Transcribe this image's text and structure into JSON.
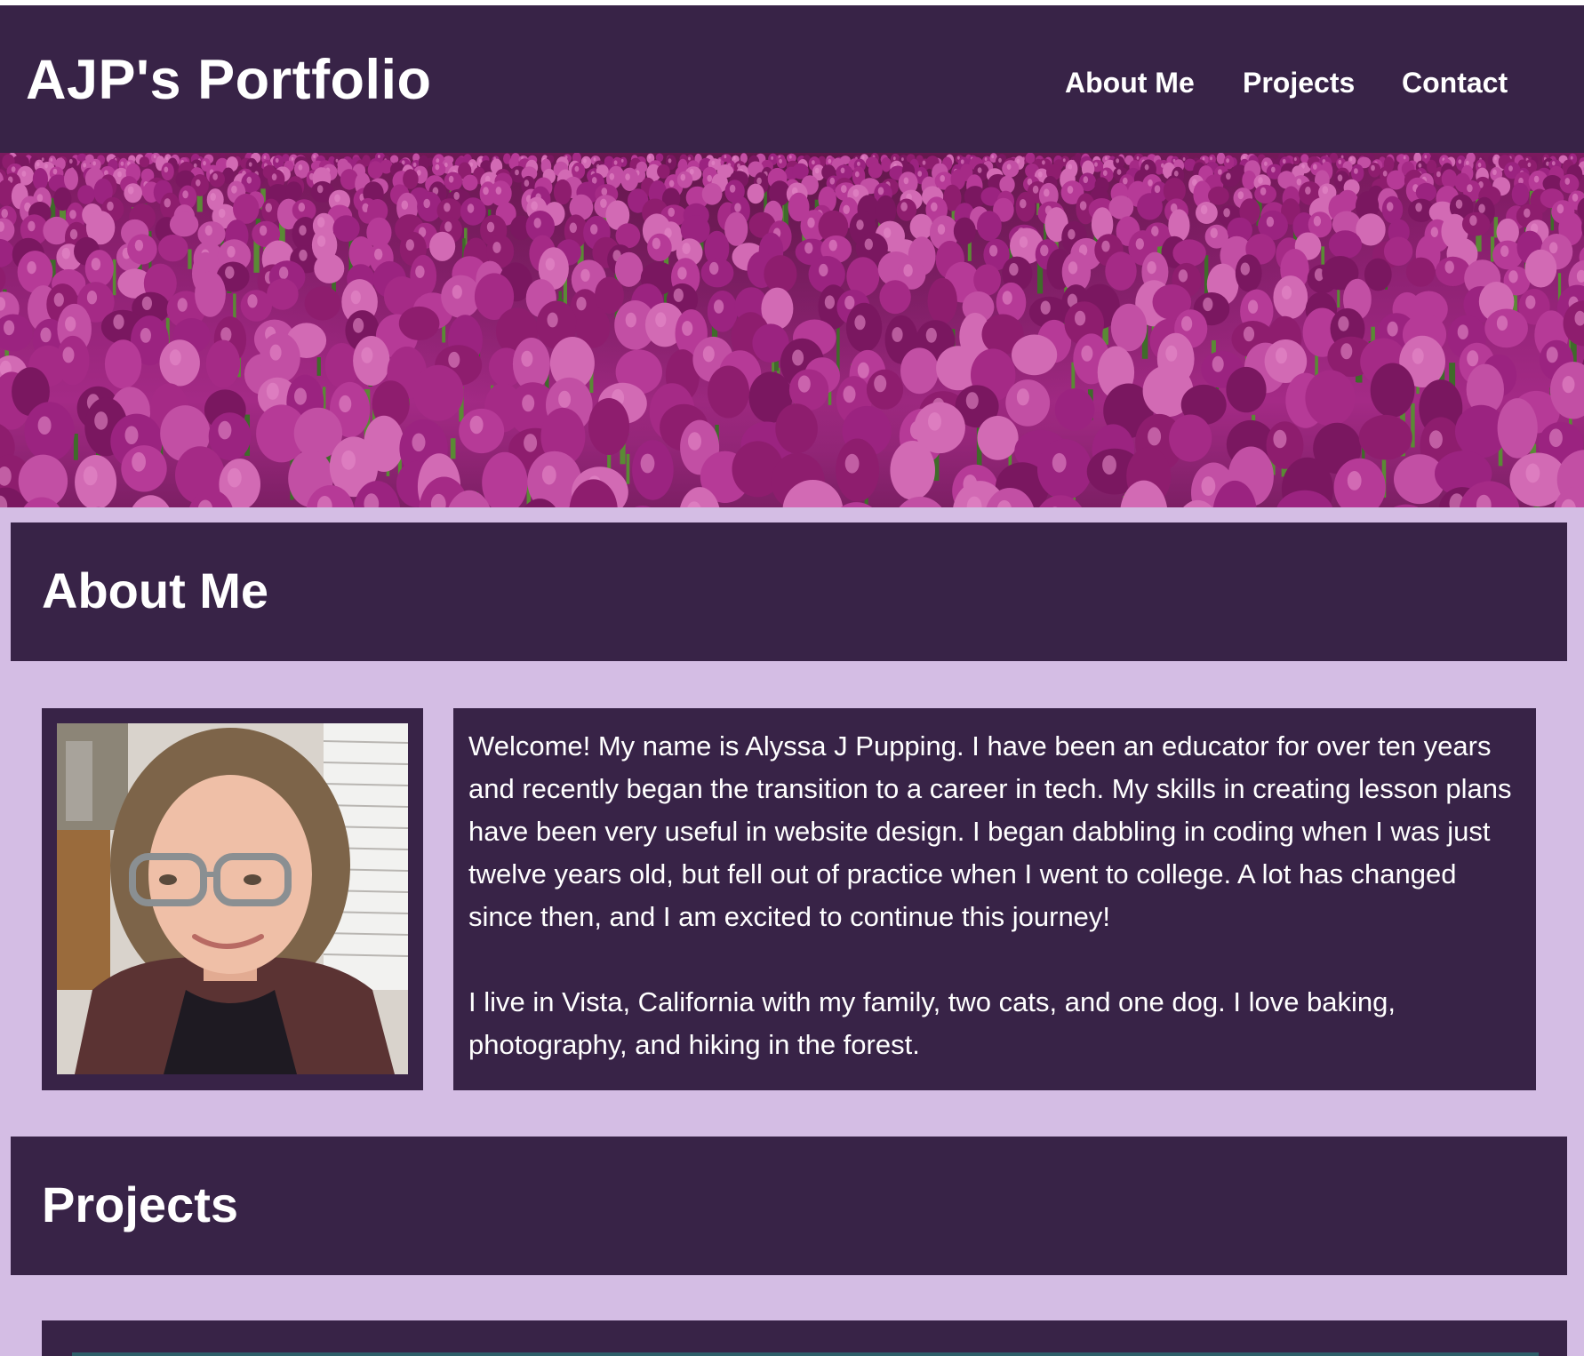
{
  "header": {
    "title": "AJP's Portfolio",
    "nav": [
      {
        "label": "About Me"
      },
      {
        "label": "Projects"
      },
      {
        "label": "Contact"
      }
    ]
  },
  "hero": {
    "icon": "tulip-field-image"
  },
  "about": {
    "heading": "About Me",
    "photo_icon": "profile-photo",
    "paragraphs": [
      "Welcome! My name is Alyssa J Pupping. I have been an educator for over ten years and recently began the transition to a career in tech. My skills in creating lesson plans have been very useful in website design. I began dabbling in coding when I was just twelve years old, but fell out of practice when I went to college. A lot has changed since then, and I am excited to continue this journey!",
      "I live in Vista, California with my family, two cats, and one dog. I love baking, photography, and hiking in the forest."
    ]
  },
  "projects": {
    "heading": "Projects"
  },
  "colors": {
    "page_bg": "#d4bde4",
    "panel_bg": "#382347",
    "text": "#ffffff",
    "tulip": "#a42a86"
  }
}
